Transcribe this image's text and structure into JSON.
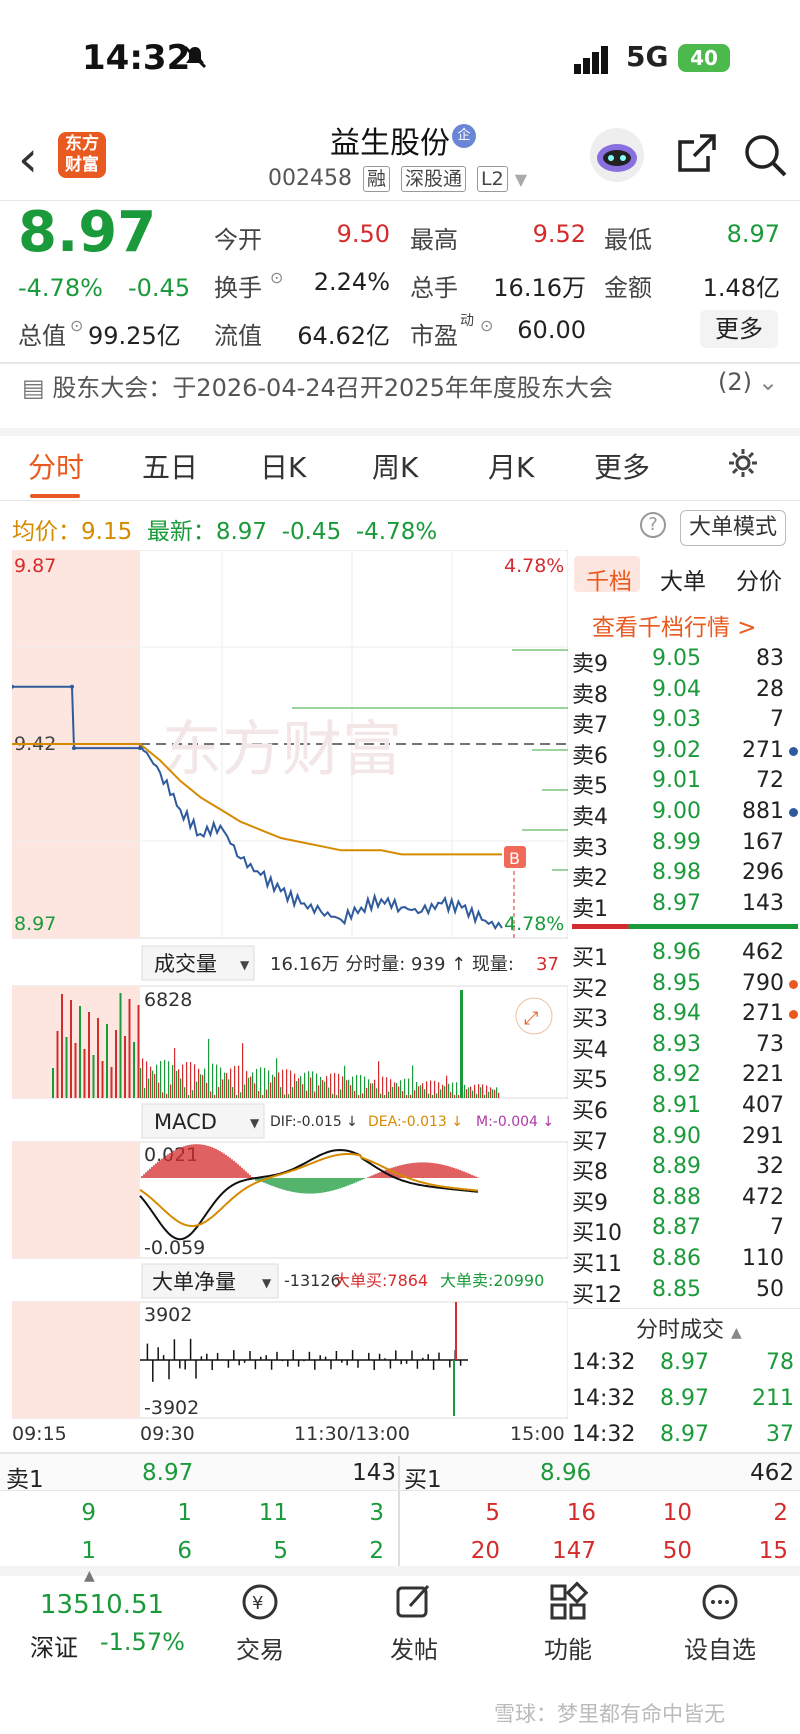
{
  "status": {
    "time": "14:32",
    "network": "5G",
    "battery": "40"
  },
  "header": {
    "logo": "东方财富",
    "title": "益生股份",
    "title_badge": "企",
    "code": "002458",
    "tags": [
      "融",
      "深股通",
      "L2"
    ]
  },
  "quote": {
    "price": "8.97",
    "change_pct": "-4.78%",
    "change": "-0.45",
    "open_label": "今开",
    "open": "9.50",
    "high_label": "最高",
    "high": "9.52",
    "low_label": "最低",
    "low": "8.97",
    "turnover_label": "换手",
    "turnover": "2.24%",
    "volume_label": "总手",
    "volume": "16.16万",
    "amount_label": "金额",
    "amount": "1.48亿",
    "mktcap_label": "总值",
    "mktcap": "99.25亿",
    "float_label": "流值",
    "float": "64.62亿",
    "pe_label": "市盈",
    "pe_sup": "动",
    "pe": "60.00",
    "more": "更多"
  },
  "notice": {
    "text": "股东大会：于2026-04-24召开2025年年度股东大会",
    "count": "(2)"
  },
  "tabs": [
    "分时",
    "五日",
    "日K",
    "周K",
    "月K",
    "更多"
  ],
  "info": {
    "avg_label": "均价：",
    "avg": "9.15",
    "latest_label": "最新：",
    "latest": "8.97",
    "chg": "-0.45",
    "pct": "-4.78%",
    "mode_btn": "大单模式"
  },
  "chart": {
    "price_top": "9.87",
    "price_mid": "9.42",
    "price_bot": "8.97",
    "pct_top": "4.78%",
    "pct_bot": "4.78%",
    "marker": "B",
    "vol_selector": "成交量",
    "vol_info": "16.16万 分时量: 939 ↑ 现量:",
    "vol_now": "37",
    "vol_max": "6828",
    "macd_selector": "MACD",
    "dif": "DIF:-0.015 ↓",
    "dea": "DEA:-0.013 ↓",
    "m": "M:-0.004 ↓",
    "macd_top": "0.021",
    "macd_bot": "-0.059",
    "net_selector": "大单净量",
    "net_val": "-13126",
    "net_buy": "大单买:7864",
    "net_sell": "大单卖:20990",
    "net_top": "3902",
    "net_bot": "-3902",
    "time_labels": [
      "09:15",
      "09:30",
      "11:30/13:00",
      "15:00"
    ],
    "watermark": "东方财富"
  },
  "chart_data": {
    "type": "line",
    "title": "",
    "series": [
      {
        "name": "",
        "values": [
          9.56,
          9.56,
          9.41,
          9.41,
          9.42,
          9.35,
          9.26,
          9.2,
          9.22,
          9.14,
          9.1,
          9.06,
          9.03,
          9.01,
          8.99,
          9.02,
          9.04,
          9.02,
          9.01,
          9.03,
          9.02,
          8.99,
          8.97
        ]
      },
      {
        "name": "均价",
        "values": [
          9.42,
          9.42,
          9.42,
          9.42,
          9.42,
          9.38,
          9.33,
          9.29,
          9.26,
          9.23,
          9.21,
          9.19,
          9.18,
          9.17,
          9.16,
          9.16,
          9.16,
          9.15,
          9.15,
          9.15,
          9.15,
          9.15,
          9.15
        ]
      }
    ],
    "ylim": [
      8.97,
      9.87
    ]
  },
  "orderbook": {
    "tabs": [
      "千档",
      "大单",
      "分价"
    ],
    "link": "查看千档行情 >",
    "asks": [
      {
        "label": "卖9",
        "price": "9.05",
        "vol": "83"
      },
      {
        "label": "卖8",
        "price": "9.04",
        "vol": "28"
      },
      {
        "label": "卖7",
        "price": "9.03",
        "vol": "7"
      },
      {
        "label": "卖6",
        "price": "9.02",
        "vol": "271"
      },
      {
        "label": "卖5",
        "price": "9.01",
        "vol": "72"
      },
      {
        "label": "卖4",
        "price": "9.00",
        "vol": "881"
      },
      {
        "label": "卖3",
        "price": "8.99",
        "vol": "167"
      },
      {
        "label": "卖2",
        "price": "8.98",
        "vol": "296"
      },
      {
        "label": "卖1",
        "price": "8.97",
        "vol": "143"
      }
    ],
    "bids": [
      {
        "label": "买1",
        "price": "8.96",
        "vol": "462"
      },
      {
        "label": "买2",
        "price": "8.95",
        "vol": "790"
      },
      {
        "label": "买3",
        "price": "8.94",
        "vol": "271"
      },
      {
        "label": "买4",
        "price": "8.93",
        "vol": "73"
      },
      {
        "label": "买5",
        "price": "8.92",
        "vol": "221"
      },
      {
        "label": "买6",
        "price": "8.91",
        "vol": "407"
      },
      {
        "label": "买7",
        "price": "8.90",
        "vol": "291"
      },
      {
        "label": "买8",
        "price": "8.89",
        "vol": "32"
      },
      {
        "label": "买9",
        "price": "8.88",
        "vol": "472"
      },
      {
        "label": "买10",
        "price": "8.87",
        "vol": "7"
      },
      {
        "label": "买11",
        "price": "8.86",
        "vol": "110"
      },
      {
        "label": "买12",
        "price": "8.85",
        "vol": "50"
      }
    ],
    "trades_title": "分时成交",
    "trades": [
      {
        "time": "14:32",
        "price": "8.97",
        "vol": "78"
      },
      {
        "time": "14:32",
        "price": "8.97",
        "vol": "211"
      },
      {
        "time": "14:32",
        "price": "8.97",
        "vol": "37"
      }
    ]
  },
  "queue": {
    "sell_label": "卖1",
    "sell_price": "8.97",
    "sell_vol": "143",
    "buy_label": "买1",
    "buy_price": "8.96",
    "buy_vol": "462",
    "sell_q": [
      [
        "9",
        "1",
        "11",
        "3"
      ],
      [
        "1",
        "6",
        "5",
        "2"
      ]
    ],
    "buy_q": [
      [
        "5",
        "16",
        "10",
        "2"
      ],
      [
        "20",
        "147",
        "50",
        "15"
      ]
    ]
  },
  "nav": {
    "index_value": "13510.51",
    "index_name": "深证",
    "index_pct": "-1.57%",
    "items": [
      "交易",
      "发帖",
      "功能",
      "设自选"
    ],
    "watermark": "雪球：梦里都有命中皆无"
  }
}
